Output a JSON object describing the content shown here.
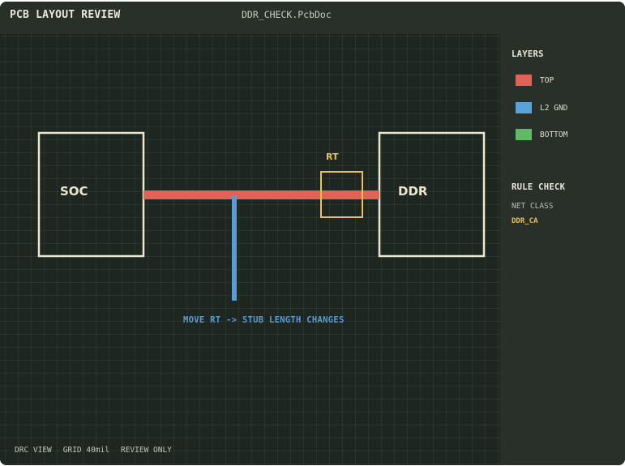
{
  "header": {
    "app_title": "PCB LAYOUT REVIEW",
    "document_name": "DDR_CHECK.PcbDoc"
  },
  "canvas": {
    "components": [
      {
        "label": "SOC"
      },
      {
        "label": "DDR"
      },
      {
        "label": "RT"
      }
    ],
    "annotation": "MOVE RT -> STUB LENGTH CHANGES",
    "colors": {
      "outline": "#ede5cc",
      "top_trace": "#e06356",
      "stub_trace": "#5b9bd0",
      "rt_outline": "#e7c155"
    }
  },
  "status_bar": {
    "items": [
      "DRC VIEW",
      "GRID 40mil",
      "REVIEW ONLY"
    ]
  },
  "sidebar": {
    "layers_heading": "LAYERS",
    "layers": [
      {
        "name": "TOP",
        "color": "#e06356"
      },
      {
        "name": "L2 GND",
        "color": "#5aa3d8"
      },
      {
        "name": "BOTTOM",
        "color": "#5fba68"
      }
    ],
    "rule_heading": "RULE CHECK",
    "net_class_label": "NET CLASS",
    "net_class_value": "DDR_CA"
  }
}
